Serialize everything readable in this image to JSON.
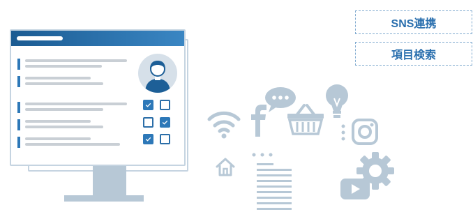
{
  "tags": {
    "sns": "SNS連携",
    "search": "項目検索"
  },
  "icons": [
    "wifi-icon",
    "facebook-icon",
    "chat-bubble-icon",
    "shopping-basket-icon",
    "lightbulb-icon",
    "instagram-icon",
    "home-icon",
    "document-icon",
    "gear-icon",
    "video-play-icon",
    "user-avatar-icon",
    "checkbox-icon"
  ],
  "colors": {
    "accent": "#2d78b8",
    "header_dark": "#1b5b92",
    "icon_gray": "#b7c8d6",
    "tag_text": "#2a6fae",
    "tag_border": "#7ea9cf"
  },
  "checkboxes": [
    {
      "row": 1,
      "left_checked": true,
      "right_checked": false
    },
    {
      "row": 2,
      "left_checked": false,
      "right_checked": true
    },
    {
      "row": 3,
      "left_checked": true,
      "right_checked": false
    }
  ]
}
